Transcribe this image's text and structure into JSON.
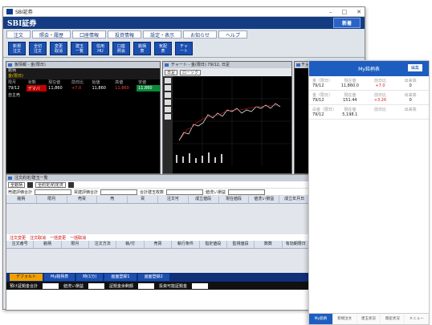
{
  "window": {
    "title": "SBI証券",
    "brand": "SBI証券",
    "new_button": "新着"
  },
  "menu": [
    "注文",
    "照会・履歴",
    "口座情報",
    "投資情報",
    "設定・表示",
    "お知らせ",
    "ヘルプ"
  ],
  "toolbar": [
    "新規\n注文",
    "全切\n注文",
    "変更\n取消",
    "建玉\n一覧",
    "信用\nHU",
    "口座\n照会",
    "銘柄\n表",
    "気配\n表",
    "チャ\nート"
  ],
  "panel_quote": {
    "title": "板情報 - 金(限日)",
    "sub": "銘柄",
    "sub2": "金(限日)",
    "headers": [
      "限月",
      "状態",
      "現在値",
      "前日比",
      "始値",
      "高値",
      "安値"
    ],
    "row": [
      "79/12",
      "",
      "11,860",
      "+7.0",
      "11,860",
      "11,860",
      "11,860"
    ],
    "footer": "自主売"
  },
  "panel_chart": {
    "title": "チャート - 金(限日)  79/12, 日足",
    "period": "日足",
    "tool": "ローソク"
  },
  "panel_side": {
    "title": "チャ"
  },
  "lower": {
    "title": "注文約定/建玉一覧",
    "filter": "全銘柄",
    "filter2": "全約定/約定済",
    "stats": [
      "売建評価合計",
      "買建評価合計",
      "合計建玉枚数",
      "値洗い損益"
    ],
    "headers1": [
      "銘柄",
      "限月",
      "売買",
      "売",
      "買",
      "注文可",
      "成立値段",
      "現在値段",
      "値洗い損益",
      "成立年月日"
    ],
    "links": [
      "注文変更",
      "注文取消",
      "一括変更",
      "一括取消"
    ],
    "headers2": [
      "注文番号",
      "銘柄",
      "限月",
      "注文方法",
      "執/付",
      "売買",
      "執行条件",
      "指定値段",
      "監視値段",
      "数数",
      "有効期限日"
    ],
    "tabs": [
      "デフォルト",
      "My銘柄表",
      "時(1分)",
      "画面登録1",
      "画面登録2"
    ],
    "bottom": [
      "預け証拠金合計",
      "値洗い損益",
      "証拠金余剰額",
      "投資可能証拠金"
    ]
  },
  "phone": {
    "title": "My銘柄表",
    "edit": "編集",
    "rows": [
      {
        "name": "金（限日）",
        "code": "79/12",
        "cols": [
          "現在値",
          "前日比",
          "出来高"
        ],
        "vals": [
          "11,860.0",
          "+7.0",
          "0"
        ]
      },
      {
        "name": "金（限日）",
        "code": "79/12",
        "cols": [
          "現在値",
          "前日比",
          "出来高"
        ],
        "vals": [
          "151.44",
          "+3.26",
          "0"
        ]
      },
      {
        "name": "白金（限日）",
        "code": "79/12",
        "cols": [
          "現在値",
          "前日比",
          "出来高"
        ],
        "vals": [
          "5,198.1",
          "",
          ""
        ]
      }
    ],
    "nav": [
      "My銘柄",
      "新規注文",
      "建玉状況",
      "資産状況",
      "メニュー"
    ]
  },
  "colors": {
    "brand": "#143c82",
    "accent": "#1d5dbf",
    "up": "#e02020",
    "tab_active": "#f1a000"
  }
}
